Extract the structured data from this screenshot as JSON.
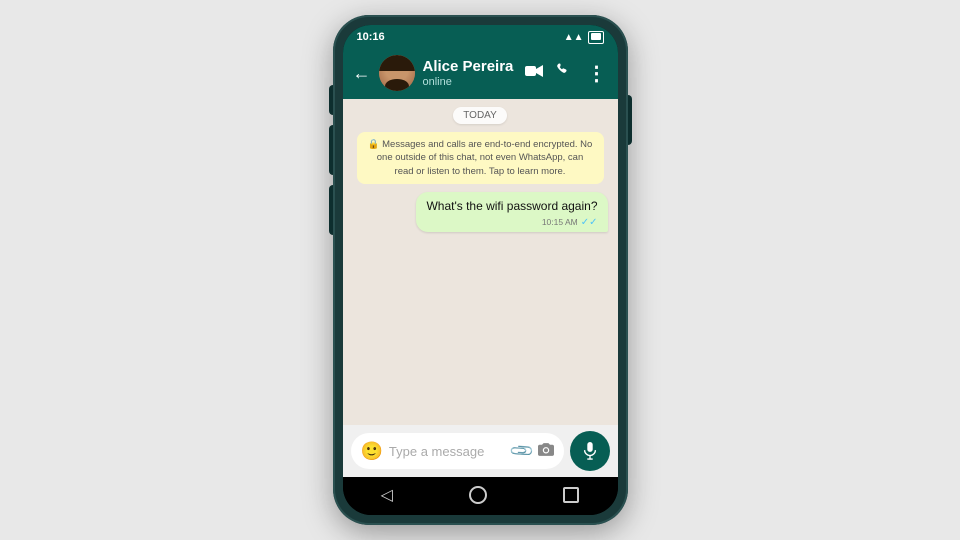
{
  "scene": {
    "bg_color": "#e8e8e8"
  },
  "status_bar": {
    "time": "10:16",
    "signal_label": "signal",
    "wifi_label": "wifi",
    "battery_label": "battery"
  },
  "header": {
    "back_label": "‹",
    "contact_name": "Alice Pereira",
    "contact_status": "online",
    "video_call_icon": "📹",
    "call_icon": "📞",
    "more_icon": "⋮"
  },
  "date_badge": {
    "label": "TODAY"
  },
  "encryption_notice": {
    "text": "🔒 Messages and calls are end-to-end encrypted. No one outside of this chat, not even WhatsApp, can read or listen to them. Tap to learn more."
  },
  "messages": [
    {
      "id": "msg1",
      "text": "What's the wifi password again?",
      "time": "10:15 AM",
      "direction": "out",
      "read": true
    }
  ],
  "input_bar": {
    "placeholder": "Type a message",
    "emoji_icon": "😊",
    "attach_icon": "📎",
    "camera_icon": "📷",
    "mic_icon": "🎤"
  },
  "nav_bar": {
    "back_icon": "◁",
    "home_icon": "○",
    "recent_icon": "□"
  }
}
